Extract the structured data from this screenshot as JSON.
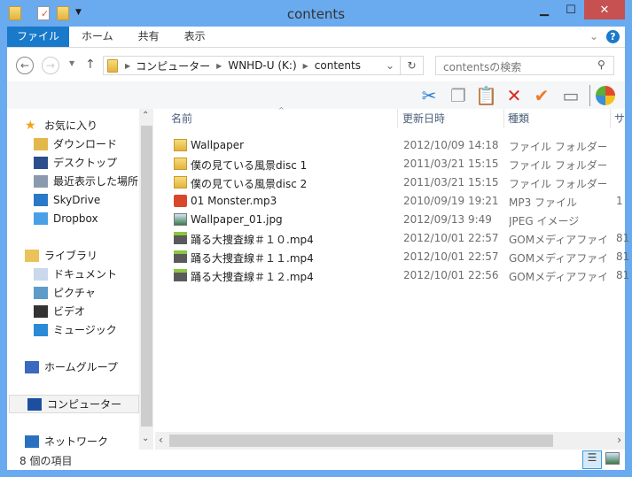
{
  "window": {
    "title": "contents",
    "minimize": "▁",
    "maximize": "☐",
    "close": "✕"
  },
  "ribbon": {
    "tabs": [
      "ファイル",
      "ホーム",
      "共有",
      "表示"
    ]
  },
  "address": {
    "segments": [
      "コンピューター",
      "WNHD-U (K:)",
      "contents"
    ],
    "search_placeholder": "contentsの検索"
  },
  "sidebar": {
    "items": [
      {
        "label": "お気に入り",
        "icon": "star-icon"
      },
      {
        "label": "ダウンロード",
        "icon": "downloads-icon"
      },
      {
        "label": "デスクトップ",
        "icon": "desktop-icon"
      },
      {
        "label": "最近表示した場所",
        "icon": "recent-places-icon"
      },
      {
        "label": "SkyDrive",
        "icon": "skydrive-icon"
      },
      {
        "label": "Dropbox",
        "icon": "dropbox-icon"
      },
      {
        "label": "ライブラリ",
        "icon": "library-icon"
      },
      {
        "label": "ドキュメント",
        "icon": "documents-icon"
      },
      {
        "label": "ピクチャ",
        "icon": "pictures-icon"
      },
      {
        "label": "ビデオ",
        "icon": "videos-icon"
      },
      {
        "label": "ミュージック",
        "icon": "music-icon"
      },
      {
        "label": "ホームグループ",
        "icon": "homegroup-icon"
      },
      {
        "label": "コンピューター",
        "icon": "computer-icon"
      },
      {
        "label": "ネットワーク",
        "icon": "network-icon"
      }
    ]
  },
  "columns": [
    "名前",
    "更新日時",
    "種類",
    "サ"
  ],
  "files": [
    {
      "name": "Wallpaper",
      "date": "2012/10/09 14:18",
      "type": "ファイル フォルダー",
      "size": "",
      "icon": "folder"
    },
    {
      "name": "僕の見ている風景disc 1",
      "date": "2011/03/21 15:15",
      "type": "ファイル フォルダー",
      "size": "",
      "icon": "folder"
    },
    {
      "name": "僕の見ている風景disc 2",
      "date": "2011/03/21 15:15",
      "type": "ファイル フォルダー",
      "size": "",
      "icon": "folder"
    },
    {
      "name": "01 Monster.mp3",
      "date": "2010/09/19 19:21",
      "type": "MP3 ファイル",
      "size": "1",
      "icon": "mp3"
    },
    {
      "name": "Wallpaper_01.jpg",
      "date": "2012/09/13 9:49",
      "type": "JPEG イメージ",
      "size": "",
      "icon": "jpg"
    },
    {
      "name": "踊る大捜査線＃１０.mp4",
      "date": "2012/10/01 22:57",
      "type": "GOMメディアファイ...",
      "size": "81",
      "icon": "mp4"
    },
    {
      "name": "踊る大捜査線＃１１.mp4",
      "date": "2012/10/01 22:57",
      "type": "GOMメディアファイ...",
      "size": "81",
      "icon": "mp4"
    },
    {
      "name": "踊る大捜査線＃１２.mp4",
      "date": "2012/10/01 22:56",
      "type": "GOMメディアファイ...",
      "size": "81",
      "icon": "mp4"
    }
  ],
  "status": {
    "count": "8 個の項目"
  }
}
